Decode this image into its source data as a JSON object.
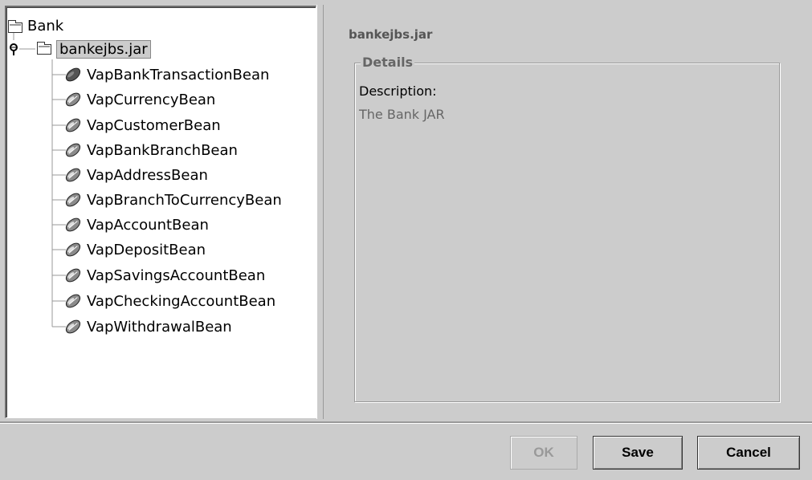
{
  "tree": {
    "root": {
      "label": "Bank",
      "icon": "folder-icon"
    },
    "jar": {
      "label": "bankejbs.jar",
      "icon": "folder-icon",
      "expanded": true,
      "selected": true
    },
    "beans": [
      {
        "label": "VapBankTransactionBean",
        "icon": "entity-bean-icon"
      },
      {
        "label": "VapCurrencyBean",
        "icon": "entity-bean-icon"
      },
      {
        "label": "VapCustomerBean",
        "icon": "entity-bean-icon"
      },
      {
        "label": "VapBankBranchBean",
        "icon": "entity-bean-icon"
      },
      {
        "label": "VapAddressBean",
        "icon": "entity-bean-icon"
      },
      {
        "label": "VapBranchToCurrencyBean",
        "icon": "entity-bean-icon"
      },
      {
        "label": "VapAccountBean",
        "icon": "entity-bean-icon"
      },
      {
        "label": "VapDepositBean",
        "icon": "entity-bean-icon"
      },
      {
        "label": "VapSavingsAccountBean",
        "icon": "entity-bean-icon"
      },
      {
        "label": "VapCheckingAccountBean",
        "icon": "entity-bean-icon"
      },
      {
        "label": "VapWithdrawalBean",
        "icon": "entity-bean-icon"
      }
    ]
  },
  "details": {
    "title": "bankejbs.jar",
    "group_label": "Details",
    "description_label": "Description:",
    "description_value": "The Bank JAR"
  },
  "buttons": {
    "ok": {
      "label": "OK",
      "enabled": false
    },
    "save": {
      "label": "Save",
      "enabled": true
    },
    "cancel": {
      "label": "Cancel",
      "enabled": true
    }
  },
  "colors": {
    "background": "#cccccc",
    "tree_background": "#ffffff",
    "muted_text": "#666666"
  }
}
